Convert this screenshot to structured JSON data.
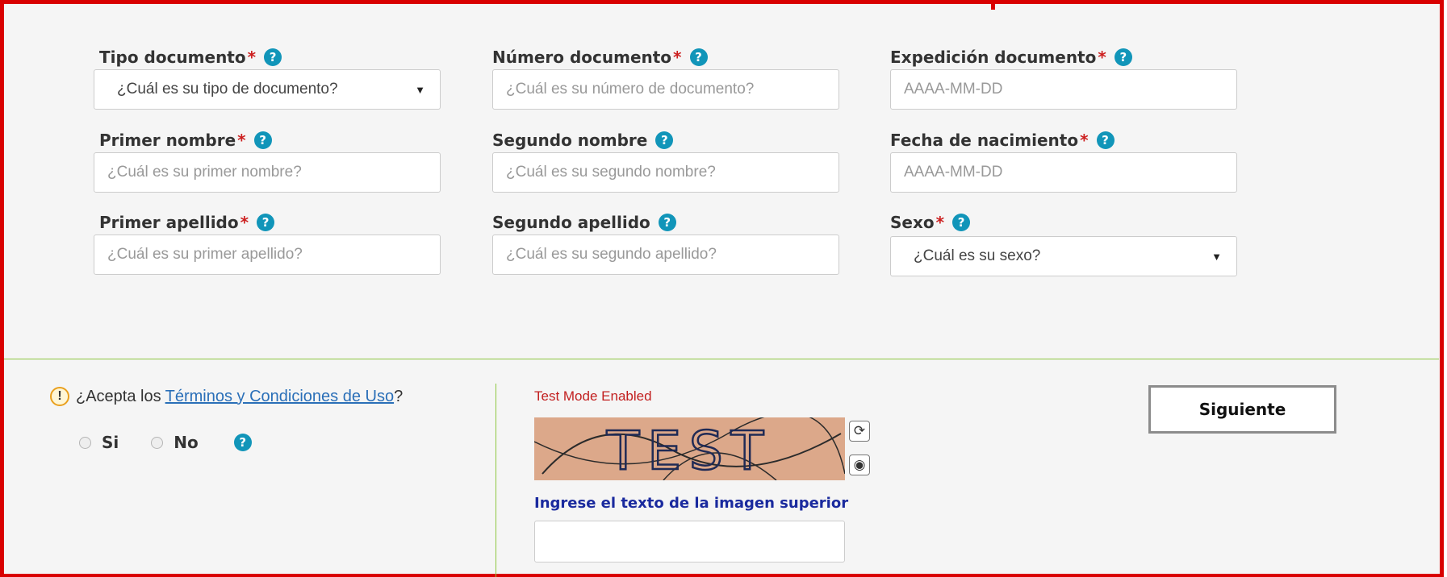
{
  "fields": {
    "tipo_documento": {
      "label": "Tipo documento",
      "required": "*",
      "value": "¿Cuál es su tipo de documento?"
    },
    "numero_documento": {
      "label": "Número documento",
      "required": "*",
      "placeholder": "¿Cuál es su número de documento?"
    },
    "expedicion_documento": {
      "label": "Expedición documento",
      "required": "*",
      "placeholder": "AAAA-MM-DD"
    },
    "primer_nombre": {
      "label": "Primer nombre",
      "required": "*",
      "placeholder": "¿Cuál es su primer nombre?"
    },
    "segundo_nombre": {
      "label": "Segundo nombre",
      "placeholder": "¿Cuál es su segundo nombre?"
    },
    "fecha_nacimiento": {
      "label": "Fecha de nacimiento",
      "required": "*",
      "placeholder": "AAAA-MM-DD"
    },
    "primer_apellido": {
      "label": "Primer apellido",
      "required": "*",
      "placeholder": "¿Cuál es su primer apellido?"
    },
    "segundo_apellido": {
      "label": "Segundo apellido",
      "placeholder": "¿Cuál es su segundo apellido?"
    },
    "sexo": {
      "label": "Sexo",
      "required": "*",
      "value": "¿Cuál es su sexo?"
    }
  },
  "help_glyph": "?",
  "caret_glyph": "▼",
  "terms": {
    "prefix": "¿Acepta los",
    "link": "Términos y Condiciones de Uso",
    "suffix": "?",
    "icon_glyph": "!",
    "options": [
      {
        "label": "Si"
      },
      {
        "label": "No"
      }
    ]
  },
  "captcha": {
    "test_mode": "Test Mode Enabled",
    "image_text": "TEST",
    "refresh_glyph": "⟳",
    "audio_glyph": "◉",
    "prompt": "Ingrese el texto de la imagen superior",
    "input_value": ""
  },
  "next_button": "Siguiente",
  "colors": {
    "frame": "#d90000",
    "help": "#1195b9",
    "required": "#cc1f1f",
    "separator": "#8dc63f",
    "link": "#2a6fb8",
    "prompt": "#1a2a9e"
  }
}
